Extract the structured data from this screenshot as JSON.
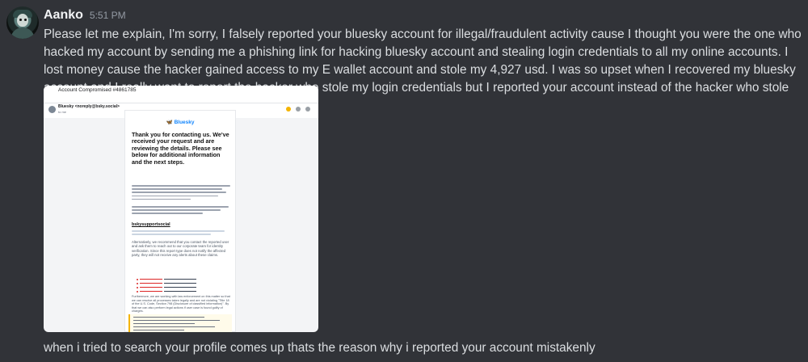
{
  "message": {
    "author": "Aanko",
    "timestamp": "5:51 PM",
    "text": "Please let me explain, I'm sorry, I falsely reported your bluesky account for illegal/fraudulent activity cause I thought you were the one who hacked my account by sending me a phishing link for hacking bluesky  account and stealing login credentials to all my online accounts. I lost money cause the hacker gained access to my E wallet account and stole my 4,927 usd. I was so upset when I recovered my bluesky  account and I really want to report the hacker who stole my login credentials but I reported your account instead of the hacker who stole my login credentials",
    "followup_text": "when i tried to search your profile comes up thats the reason why i reported your account mistakenly"
  },
  "attachment": {
    "email_subject": "Account Compromised #4861785",
    "sender_name": "Bluesky <noreply@bsky.social>",
    "sender_sub": "to me",
    "brand": "Bluesky",
    "heading": "Thank you for contacting us. We've received your request and are reviewing the details. Please see below for additional information and the next steps.",
    "link_text": "bskysupportsocial",
    "para_1": "Alternatively, we recommend that you contact the reported user and ask them to reach out to our corporate team for identity verification. Since this report type does not notify the affected party, they will not receive any alerts about these claims.",
    "para_2": "Furthermore, we are working with law enforcement on this matter so that we can resolve all processes taken legally and are not violating \"Title 18 of the U.S. Code, Section 798 (Disclosure of classified information)\". By that we can also perform legal actions if user case is found guilty of charges."
  },
  "colors": {
    "background": "#313338",
    "text": "#dbdee1",
    "username": "#f2f3f5",
    "timestamp": "#949ba4",
    "bluesky_brand": "#1185fe"
  },
  "icons": [
    "avatar",
    "butterfly-icon",
    "star-icon",
    "reply-icon",
    "more-icon"
  ]
}
